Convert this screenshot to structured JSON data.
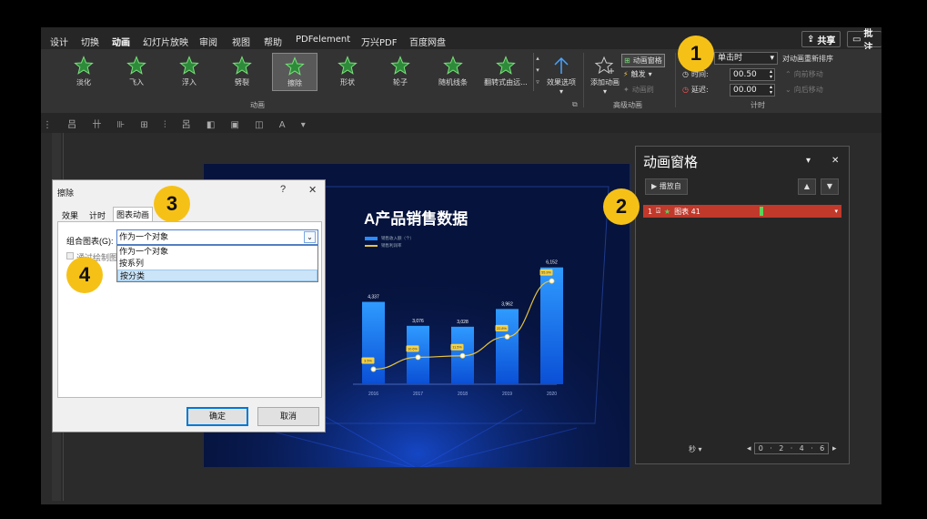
{
  "menu": {
    "tabs": [
      "设计",
      "切换",
      "动画",
      "幻灯片放映",
      "审阅",
      "视图",
      "帮助",
      "PDFelement",
      "万兴PDF",
      "百度网盘"
    ],
    "share_label": "共享",
    "comment_label": "批注"
  },
  "ribbon": {
    "animations": [
      "淡化",
      "飞入",
      "浮入",
      "劈裂",
      "擦除",
      "形状",
      "轮子",
      "随机线条",
      "翻转式由远..."
    ],
    "selected_animation": "擦除",
    "effect_options_label": "效果选项",
    "group_animation_label": "动画",
    "add_animation_label": "添加动画",
    "animation_pane_label": "动画窗格",
    "trigger_label": "触发",
    "animation_painter_label": "动画刷",
    "advanced_group_label": "高级动画",
    "start_value": "单击时",
    "duration_label": "时间:",
    "duration_value": "00.50",
    "delay_label": "延迟:",
    "delay_value": "00.00",
    "timing_group_label": "计时",
    "reorder_label": "对动画重新排序",
    "move_earlier_label": "向前移动",
    "move_later_label": "向后移动"
  },
  "callouts": [
    "1",
    "2",
    "3",
    "4"
  ],
  "slide": {
    "title": "A产品销售数据",
    "legend_bar": "销售收入额（个）",
    "legend_line": "销售利润率"
  },
  "chart_data": {
    "type": "bar",
    "categories": [
      "2016",
      "2017",
      "2018",
      "2019",
      "2020"
    ],
    "series": [
      {
        "name": "销售收入额（个）",
        "values": [
          4337,
          3076,
          3028,
          3962,
          6152
        ]
      },
      {
        "name": "销售利润率",
        "values": [
          3.5,
          10.6,
          11.5,
          22.8,
          55.9
        ],
        "labels": [
          "3.5%",
          "10.6%",
          "11.5%",
          "22.8%",
          "55.9%"
        ]
      }
    ],
    "bar_labels": [
      "4,337",
      "3,076",
      "3,028",
      "3,962",
      "6,152"
    ],
    "ylim": [
      0,
      7000
    ]
  },
  "dialog": {
    "title": "擦除",
    "help": "?",
    "close": "✕",
    "tabs": [
      "效果",
      "计时",
      "图表动画"
    ],
    "active_tab": "图表动画",
    "group_label": "组合图表(G):",
    "group_value": "作为一个对象",
    "options": [
      "作为一个对象",
      "按系列",
      "按分类"
    ],
    "highlighted_option": "按分类",
    "checkbox_label": "通过绘制图表背景启动动画效果",
    "ok_label": "确定",
    "cancel_label": "取消"
  },
  "animation_pane": {
    "title": "动画窗格",
    "play_label": "播放自",
    "item_index": "1",
    "item_name": "图表 41",
    "seconds_label": "秒",
    "timeline": [
      "0",
      "2",
      "4",
      "6"
    ]
  },
  "colors": {
    "accent": "#d25a3a",
    "callout": "#f6c117",
    "bar": "#2b8cff",
    "line": "#e8c440",
    "pane_item": "#c0392b"
  }
}
